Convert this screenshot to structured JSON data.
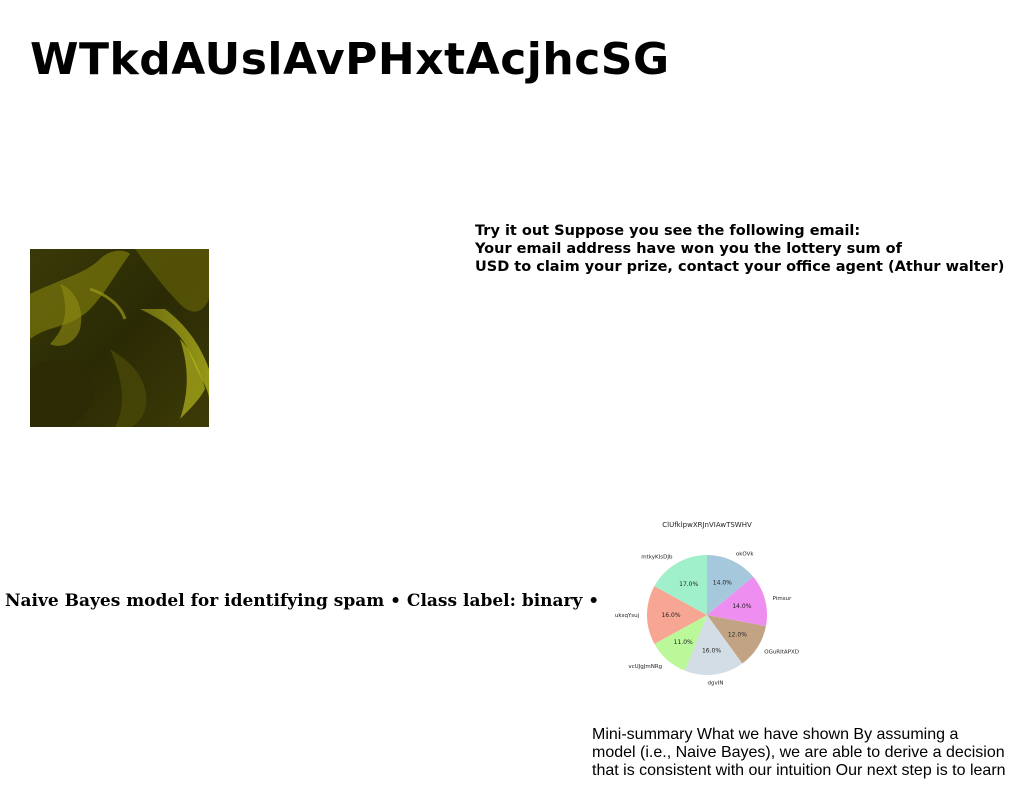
{
  "title": "WTkdAUslAvPHxtAcjhcSG",
  "email_block": {
    "lines": [
      "Try it out Suppose you see the following email:",
      "Your email address have won you the lottery sum of",
      "USD to claim your prize, contact your office agent (Athur walter)"
    ]
  },
  "bullets_text": "Naive Bayes model for identifying spam • Class label: binary •",
  "summary": {
    "lines": [
      "Mini-summary What we have shown By assuming a",
      "model (i.e., Naive Bayes), we are able to derive a decision",
      "that is consistent with our intuition Our next step is to learn"
    ]
  },
  "chart_data": {
    "type": "pie",
    "title": "ClUfklpwXRJnVIAwTSWHV",
    "slices": [
      {
        "label": "okOVk",
        "value": 14.0,
        "pct_label": "14.0%",
        "color": "#a6c8dc"
      },
      {
        "label": "Pimsur",
        "value": 14.0,
        "pct_label": "14.0%",
        "color": "#ee8ef0"
      },
      {
        "label": "OGuRItAPXD",
        "value": 12.0,
        "pct_label": "12.0%",
        "color": "#c2a484"
      },
      {
        "label": "dgvIN",
        "value": 16.0,
        "pct_label": "16.0%",
        "color": "#d3dde6"
      },
      {
        "label": "vcUJgJmNRg",
        "value": 11.0,
        "pct_label": "11.0%",
        "color": "#baf89a"
      },
      {
        "label": "uksqYsuj",
        "value": 16.0,
        "pct_label": "16.0%",
        "color": "#f7a693"
      },
      {
        "label": "mtkyKIsDJb",
        "value": 17.0,
        "pct_label": "17.0%",
        "color": "#a0f0cc"
      }
    ],
    "start_angle_deg": 90,
    "direction": "clockwise"
  }
}
